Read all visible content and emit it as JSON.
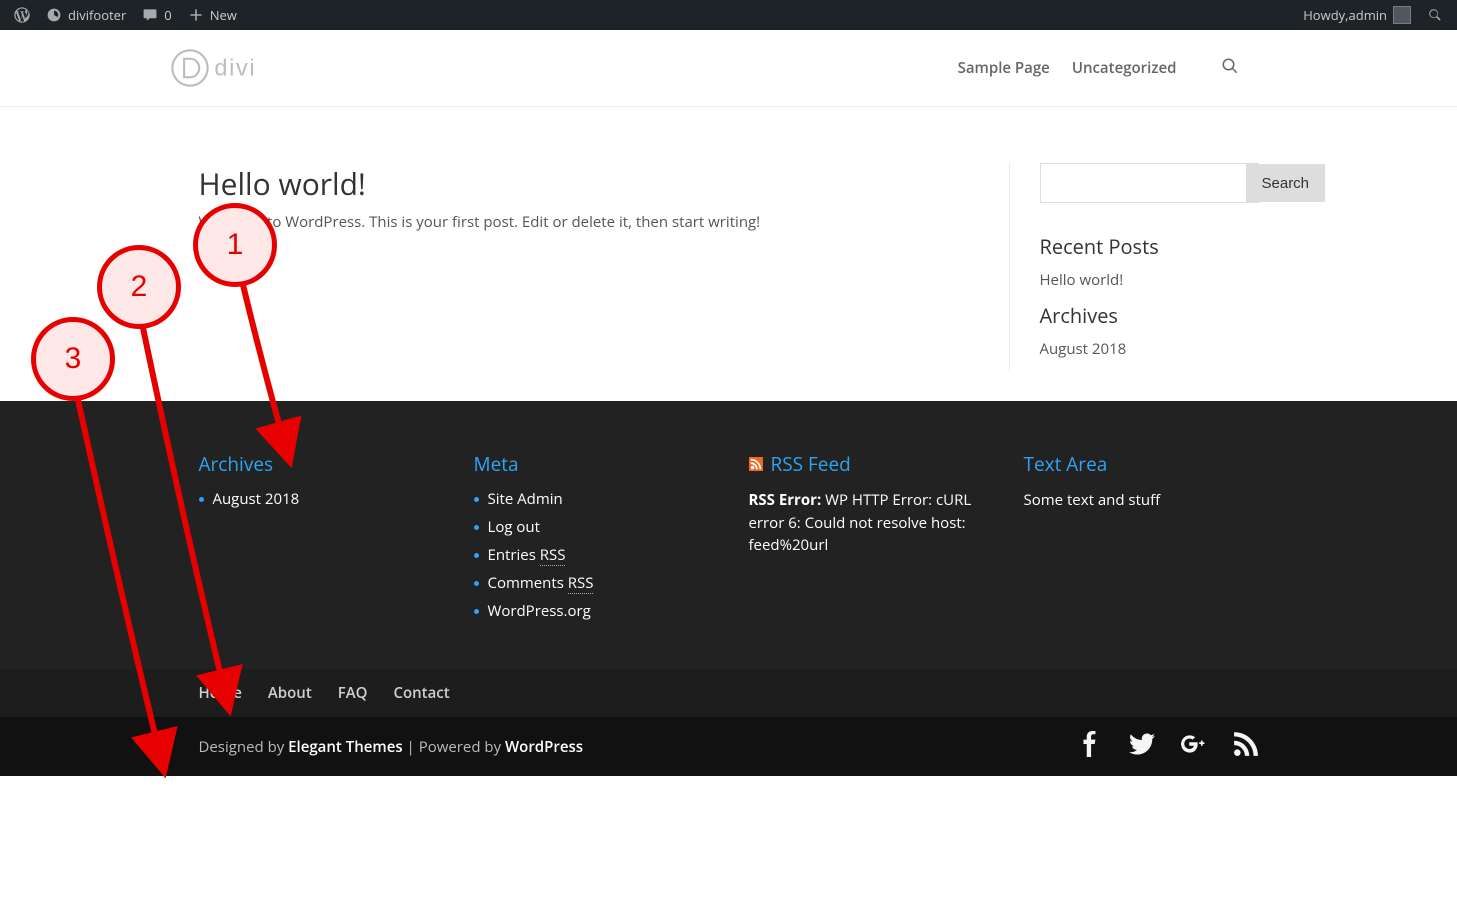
{
  "adminbar": {
    "site_name": "divifooter",
    "comments_count": "0",
    "new_label": "New",
    "howdy_prefix": "Howdy, ",
    "user_name": "admin"
  },
  "header": {
    "logo_text": "divi",
    "nav": [
      "Sample Page",
      "Uncategorized"
    ]
  },
  "post": {
    "title": "Hello world!",
    "body": "Welcome to WordPress. This is your first post. Edit or delete it, then start writing!"
  },
  "sidebar": {
    "search_button": "Search",
    "recent_title": "Recent Posts",
    "recent_items": [
      "Hello world!"
    ],
    "archives_title": "Archives",
    "archive_items": [
      "August 2018"
    ]
  },
  "footer_widgets": {
    "archives": {
      "title": "Archives",
      "items": [
        "August 2018"
      ]
    },
    "meta": {
      "title": "Meta",
      "items": [
        {
          "label": "Site Admin"
        },
        {
          "label": "Log out"
        },
        {
          "label": "Entries ",
          "abbr": "RSS"
        },
        {
          "label": "Comments ",
          "abbr": "RSS"
        },
        {
          "label": "WordPress.org"
        }
      ]
    },
    "rss": {
      "title": "RSS Feed",
      "error_label": "RSS Error:",
      "error_body": " WP HTTP Error: cURL error 6: Could not resolve host: feed%20url"
    },
    "text": {
      "title": "Text Area",
      "body": "Some text and stuff"
    }
  },
  "bottom_nav": [
    "Home",
    "About",
    "FAQ",
    "Contact"
  ],
  "credits": {
    "pre1": "Designed by ",
    "link1": "Elegant Themes",
    "mid": " | Powered by ",
    "link2": "WordPress"
  },
  "annotations": {
    "b1": "1",
    "b2": "2",
    "b3": "3"
  }
}
